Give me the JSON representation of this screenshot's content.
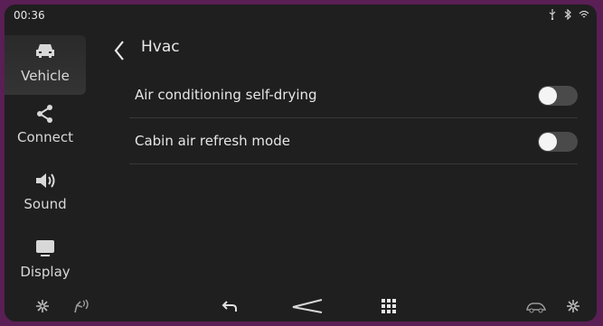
{
  "status": {
    "time": "00:36",
    "icons": [
      "usb-icon",
      "bluetooth-icon",
      "wifi-icon"
    ]
  },
  "sidebar": {
    "items": [
      {
        "label": "Vehicle",
        "icon": "car-icon",
        "active": true
      },
      {
        "label": "Connect",
        "icon": "share-icon",
        "active": false
      },
      {
        "label": "Sound",
        "icon": "speaker-icon",
        "active": false
      },
      {
        "label": "Display",
        "icon": "monitor-icon",
        "active": false
      }
    ]
  },
  "header": {
    "title": "Hvac",
    "back_icon": "chevron-left-icon"
  },
  "settings": [
    {
      "label": "Air conditioning self-drying",
      "enabled": false
    },
    {
      "label": "Cabin air refresh mode",
      "enabled": false
    }
  ],
  "bottombar": {
    "icons": [
      "fan-icon",
      "seat-airflow-icon",
      "back-arrow-icon",
      "home-logo-icon",
      "apps-grid-icon",
      "car-defrost-icon",
      "fan-icon"
    ]
  },
  "colors": {
    "background": "#1f1f1f",
    "frame": "#5a1f55",
    "toggle_off": "#4a4a4a",
    "text": "#e6e6e6"
  }
}
